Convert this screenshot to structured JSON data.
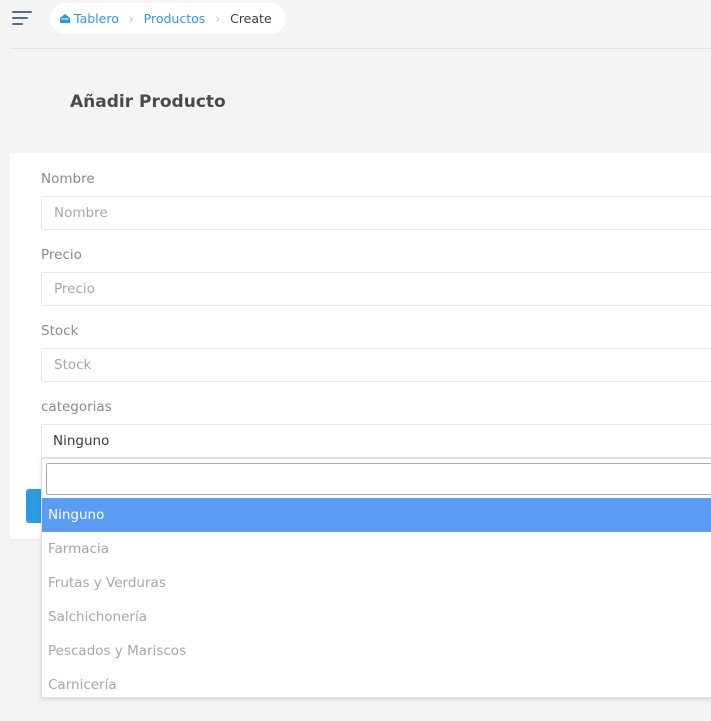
{
  "breadcrumb": {
    "home": "Tablero",
    "section": "Productos",
    "current": "Create",
    "separator": "›"
  },
  "page": {
    "title": "Añadir Producto"
  },
  "form": {
    "nombre": {
      "label": "Nombre",
      "placeholder": "Nombre"
    },
    "precio": {
      "label": "Precio",
      "placeholder": "Precio"
    },
    "stock": {
      "label": "Stock",
      "placeholder": "Stock"
    },
    "categorias": {
      "label": "categorias",
      "selected": "Ninguno"
    }
  },
  "dropdown": {
    "search_value": "",
    "options": [
      "Ninguno",
      "Farmacia",
      "Frutas y Verduras",
      "Salchichonería",
      "Pescados y Mariscos",
      "Carnicería"
    ],
    "highlighted": "Ninguno"
  },
  "colors": {
    "accent": "#2e9ae6",
    "highlight": "#5a9cf1",
    "background": "#f4f4f4"
  },
  "icons": {
    "menu": "hamburger-menu-icon",
    "home": "home-icon"
  }
}
